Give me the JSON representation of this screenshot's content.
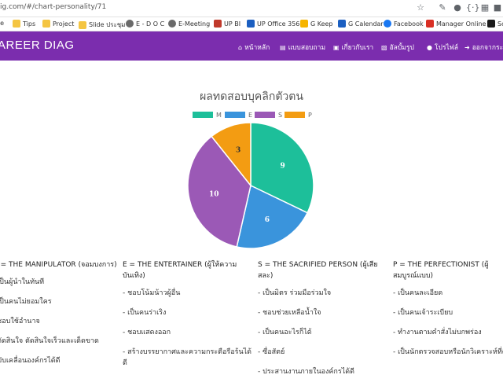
{
  "browser": {
    "url": "ig.com/#/chart-personality/71"
  },
  "bookmarks": [
    {
      "label": "se",
      "icon": "folder-icon"
    },
    {
      "label": "Tips",
      "icon": "folder-icon"
    },
    {
      "label": "Project",
      "icon": "folder-icon"
    },
    {
      "label": "Slide ประชุม",
      "icon": "folder-icon"
    },
    {
      "label": "E - D O C",
      "icon": "globe-icon"
    },
    {
      "label": "E-Meeting",
      "icon": "globe-icon"
    },
    {
      "label": "UP BI",
      "icon": "bi-icon"
    },
    {
      "label": "UP Office 356",
      "icon": "office-icon"
    },
    {
      "label": "G Keep",
      "icon": "keep-icon"
    },
    {
      "label": "G Calendar",
      "icon": "calendar-icon"
    },
    {
      "label": "Facebook",
      "icon": "facebook-icon"
    },
    {
      "label": "Manager Online",
      "icon": "gmail-icon"
    },
    {
      "label": "Sc",
      "icon": "bookmark-icon"
    }
  ],
  "navbar": {
    "brand": "AREER DIAG",
    "items": [
      {
        "label": "หน้าหลัก",
        "icon": "home-icon"
      },
      {
        "label": "แบบสอบถาม",
        "icon": "survey-icon"
      },
      {
        "label": "เกี่ยวกับเรา",
        "icon": "info-icon"
      },
      {
        "label": "อัลบั้มรูป",
        "icon": "image-icon"
      },
      {
        "label": "โปรไฟล์",
        "icon": "user-icon"
      },
      {
        "label": "ออกจากระบบ",
        "icon": "logout-icon"
      }
    ]
  },
  "chart_data": {
    "type": "pie",
    "title": "ผลทดสอบบุคลิกตัวตน",
    "labels": [
      "M",
      "E",
      "S",
      "P"
    ],
    "values": [
      9,
      6,
      10,
      3
    ],
    "colors": [
      "#1dbf9a",
      "#3a94dc",
      "#9b59b6",
      "#f39c12"
    ],
    "legend_position": "top"
  },
  "columns": [
    {
      "head": "M = THE MANIPULATOR (จอมบงการ)",
      "items": [
        "- เป็นผู้นำในทันที",
        "- เป็นคนไม่ยอมใคร",
        "- ชอบใช้อำนาจ",
        "- ตัดสินใจ ตัดสินใจเร็วและเด็ดขาด",
        "- ขับเคลื่อนองค์กรได้ดี"
      ]
    },
    {
      "head": "E = THE ENTERTAINER (ผู้ให้ความบันเทิง)",
      "items": [
        "- ชอบโน้มน้าวผู้อื่น",
        "- เป็นคนร่าเริง",
        "- ชอบแสดงออก",
        "- สร้างบรรยากาศและความกระตือรือร้นได้ดี"
      ]
    },
    {
      "head": "S = THE SACRIFIED PERSON (ผู้เสียสละ)",
      "items": [
        "- เป็นมิตร ร่วมมือร่วมใจ",
        "- ชอบช่วยเหลือน้ำใจ",
        "- เป็นคนอะไรก็ได้",
        "- ซื่อสัตย์",
        "- ประสานงานภายในองค์กรได้ดี"
      ]
    },
    {
      "head": "P = THE PERFECTIONIST (ผู้สมบูรณ์แบบ)",
      "items": [
        "- เป็นคนละเอียด",
        "- เป็นคนเจ้าระเบียบ",
        "- ทำงานตามคำสั่งไม่บกพร่อง",
        "- เป็นนักตรวจสอบหรือนักวิเคราะห์ที่ดี"
      ]
    }
  ]
}
